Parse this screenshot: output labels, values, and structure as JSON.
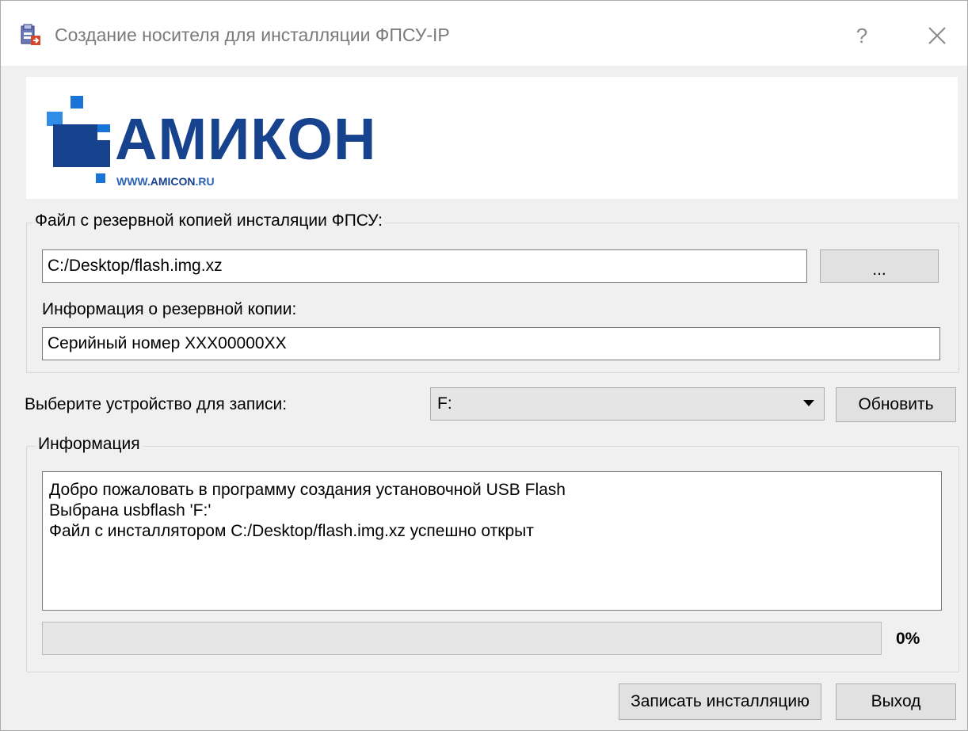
{
  "window": {
    "title": "Создание носителя для инсталляции ФПСУ-IP",
    "help_label": "?"
  },
  "logo": {
    "name": "АМИКОН",
    "url_prefix": "WWW.",
    "url_brand": "AMICON",
    "url_suffix": ".RU",
    "brand_color": "#16428e",
    "accent_color": "#1a73d9"
  },
  "backup_group": {
    "title": "Файл с резервной копией инсталяции ФПСУ:",
    "file_path": "C:/Desktop/flash.img.xz",
    "browse_label": "...",
    "info_label": "Информация о резервной копии:",
    "info_value": "Серийный номер XXX00000XX"
  },
  "device": {
    "label": "Выберите устройство для записи:",
    "selected": "F:",
    "refresh_label": "Обновить"
  },
  "info_group": {
    "title": "Информация",
    "log_lines": [
      "Добро пожаловать в программу создания установочной USB Flash",
      "Выбрана usbflash 'F:'",
      "Файл с инсталлятором C:/Desktop/flash.img.xz успешно открыт"
    ],
    "progress_fraction": 0,
    "progress_label": "0%"
  },
  "actions": {
    "write_label": "Записать инсталляцию",
    "exit_label": "Выход"
  }
}
